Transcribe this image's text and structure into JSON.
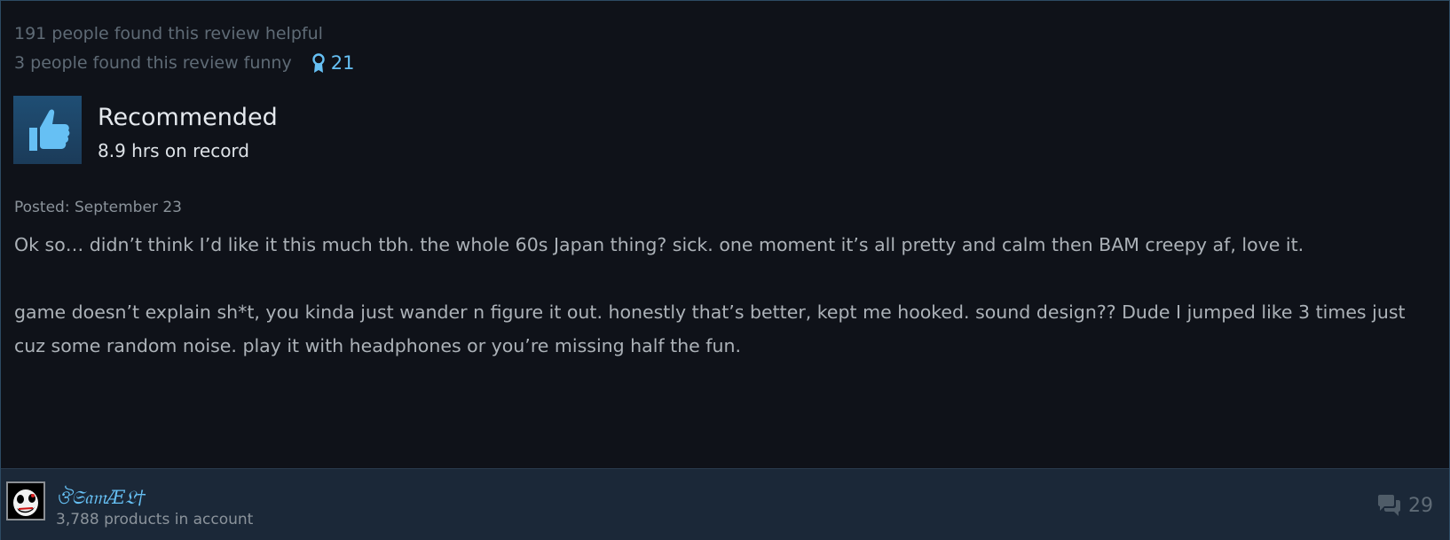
{
  "review": {
    "helpful_text": "191 people found this review helpful",
    "funny_text": "3 people found this review funny",
    "award_count": "21",
    "award_icon": "award-ribbon-icon",
    "verdict": "Recommended",
    "verdict_icon": "thumbs-up-icon",
    "hours": "8.9 hrs on record",
    "posted": "Posted: September 23",
    "paragraphs": [
      "Ok so… didn’t think I’d like it this much tbh. the whole 60s Japan thing? sick. one moment it’s all pretty and calm then BAM creepy af, love it.",
      "game doesn’t explain sh*t, you kinda just wander n figure it out. honestly that’s better, kept me hooked. sound design?? Dude I jumped like 3 times just cuz some random noise. play it with headphones or you’re missing half the fun."
    ]
  },
  "author": {
    "name": "ঔ𝔖𝔞𝔪Æ𝔏†",
    "products": "3,788 products in account",
    "comment_count": "29",
    "comment_icon": "comment-bubble-icon"
  },
  "colors": {
    "accent": "#66c0f4",
    "background": "#0f1219",
    "footer": "#1b2838"
  }
}
